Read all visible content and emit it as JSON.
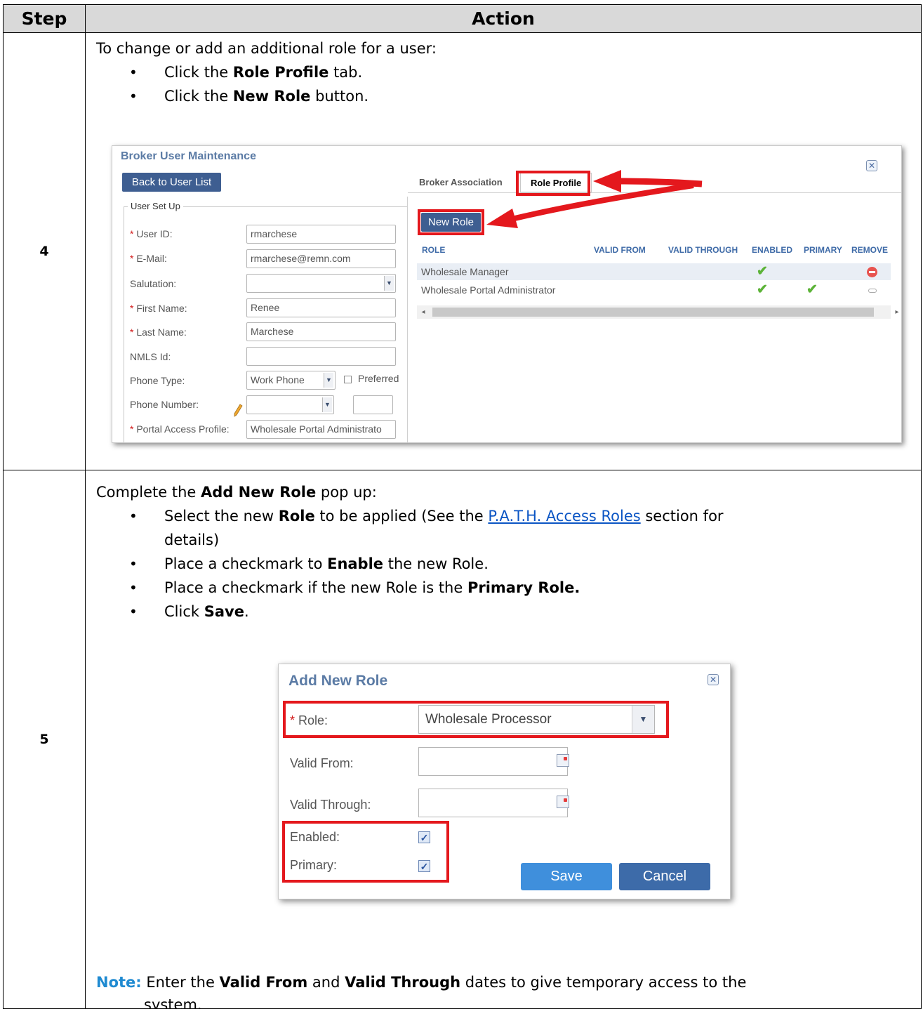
{
  "table": {
    "header_step": "Step",
    "header_action": "Action"
  },
  "step4": {
    "number": "4",
    "intro": "To change or add an additional role for a user:",
    "bullet1": {
      "pre": "Click the ",
      "bold": "Role Profile",
      "post": " tab."
    },
    "bullet2": {
      "pre": "Click the ",
      "bold": "New Role",
      "post": " button."
    }
  },
  "broker_window": {
    "title": "Broker User Maintenance",
    "close_glyph": "✕",
    "back_button": "Back to User List",
    "fieldset_legend": "User Set Up",
    "required_mark": "*",
    "fields": [
      {
        "label": " User ID:",
        "required": true,
        "value": "rmarchese"
      },
      {
        "label": " E-Mail:",
        "required": true,
        "value": "rmarchese@remn.com"
      },
      {
        "label": "Salutation:",
        "required": false,
        "value": ""
      },
      {
        "label": " First Name:",
        "required": true,
        "value": "Renee"
      },
      {
        "label": " Last Name:",
        "required": true,
        "value": "Marchese"
      },
      {
        "label": "NMLS Id:",
        "required": false,
        "value": ""
      },
      {
        "label": "Phone Type:",
        "required": false,
        "value": "Work Phone"
      },
      {
        "label": "Phone Number:",
        "required": false,
        "value": ""
      },
      {
        "label": " Portal Access Profile:",
        "required": true,
        "value": "Wholesale Portal Administrato"
      }
    ],
    "preferred_label": "Preferred",
    "tabs": [
      "Broker Association",
      "Role Profile"
    ],
    "new_role_button": "New Role",
    "grid_columns": [
      "ROLE",
      "VALID FROM",
      "VALID THROUGH",
      "ENABLED",
      "PRIMARY",
      "REMOVE"
    ],
    "grid_rows": [
      {
        "role": "Wholesale Manager",
        "enabled": true,
        "primary": false,
        "remove": "active"
      },
      {
        "role": "Wholesale Portal Administrator",
        "enabled": true,
        "primary": true,
        "remove": "disabled"
      }
    ],
    "check_glyph": "✔",
    "scroll_left": "◂",
    "scroll_right": "▸",
    "combo_glyph": "▼",
    "icons": [
      "close-icon",
      "pencil-icon",
      "check-icon",
      "remove-icon"
    ]
  },
  "step5": {
    "number": "5",
    "intro": {
      "pre": "Complete the ",
      "bold": "Add New Role",
      "post": " pop up:"
    },
    "bullet1": {
      "pre": "Select the new ",
      "bold": "Role",
      "mid": " to be applied (See the ",
      "link": "P.A.T.H. Access Roles",
      "post": " section for",
      "post2": "details)"
    },
    "bullet2": {
      "pre": "Place a checkmark to ",
      "bold": "Enable",
      "post": " the new Role."
    },
    "bullet3": {
      "pre": "Place a checkmark if the new Role is the ",
      "bold": "Primary Role."
    },
    "bullet4": {
      "pre": "Click ",
      "bold": "Save",
      "post": "."
    },
    "note": {
      "label": "Note:",
      "pre": " Enter the ",
      "bold1": "Valid From",
      "mid": " and ",
      "bold2": "Valid Through",
      "post": " dates to give temporary access to the",
      "post2": "system."
    }
  },
  "add_role_dialog": {
    "title": "Add New Role",
    "close_glyph": "✕",
    "required_mark": "*",
    "role_label": " Role:",
    "role_value": "Wholesale Processor",
    "combo_glyph": "▼",
    "valid_from_label": "Valid From:",
    "valid_from_value": "",
    "valid_through_label": "Valid Through:",
    "valid_through_value": "",
    "enabled_label": "Enabled:",
    "enabled_checked": true,
    "primary_label": "Primary:",
    "primary_checked": true,
    "check_glyph": "✓",
    "save_button": "Save",
    "cancel_button": "Cancel",
    "icons": [
      "close-icon",
      "calendar-icon",
      "checkbox-icon"
    ]
  },
  "colors": {
    "highlight_red": "#e4181d",
    "header_gray": "#d9d9d9",
    "note_blue": "#1f8ad1",
    "button_dark": "#3e5e91"
  }
}
